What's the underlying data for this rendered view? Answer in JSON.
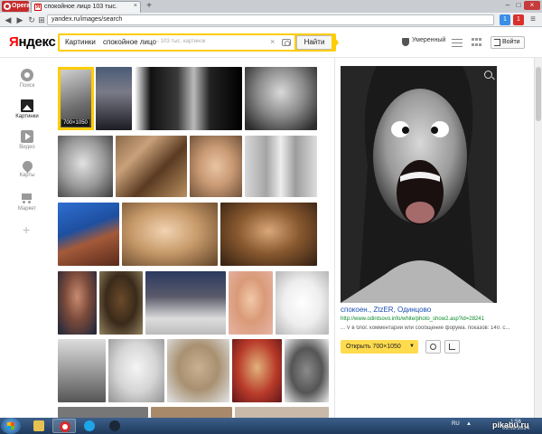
{
  "browser": {
    "menu_label": "Opera",
    "tab_title": "спокойное лицо 103 тыс.",
    "tab_favicon": "Я",
    "tab_close": "×",
    "new_tab": "+",
    "url": "yandex.ru/images/search",
    "win_min": "–",
    "win_max": "□",
    "win_close": "×",
    "ext1_label": "1",
    "ext2_label": "1"
  },
  "header": {
    "logo_prefix": "Я",
    "logo_rest": "ндекс",
    "search_service": "Картинки",
    "search_query": "спокойное лицо",
    "search_count": "— 103 тыс. картинок",
    "search_clear": "×",
    "search_button": "Найти",
    "filter_label": "Умеренный",
    "login_label": "Войти"
  },
  "sidebar": {
    "items": [
      {
        "label": "Поиск",
        "icon": "search-circle-icon"
      },
      {
        "label": "Картинки",
        "icon": "image-icon"
      },
      {
        "label": "Видео",
        "icon": "video-icon"
      },
      {
        "label": "Карты",
        "icon": "map-pin-icon"
      },
      {
        "label": "Маркет",
        "icon": "cart-icon"
      }
    ],
    "more": "+"
  },
  "grid": {
    "selected_size": "700×1050"
  },
  "preview": {
    "title": "спокоен., ZtzER, Одинцово",
    "url": "http://www.odintsovo.info/white/photo_show2.asp?id=28241",
    "description": "... V в блог. комментарий или сообщение форума. показов: 140. с...",
    "open_button": "Открыть 700×1050",
    "open_chevron": "▼"
  },
  "taskbar": {
    "lang": "RU",
    "time": "1:56",
    "date": "09.09.2014",
    "watermark": "pikabu.ru"
  },
  "colors": {
    "accent_yellow": "#ffcc00",
    "yandex_red": "#ff0000",
    "link_blue": "#1a4db3",
    "url_green": "#0a8a2a"
  }
}
